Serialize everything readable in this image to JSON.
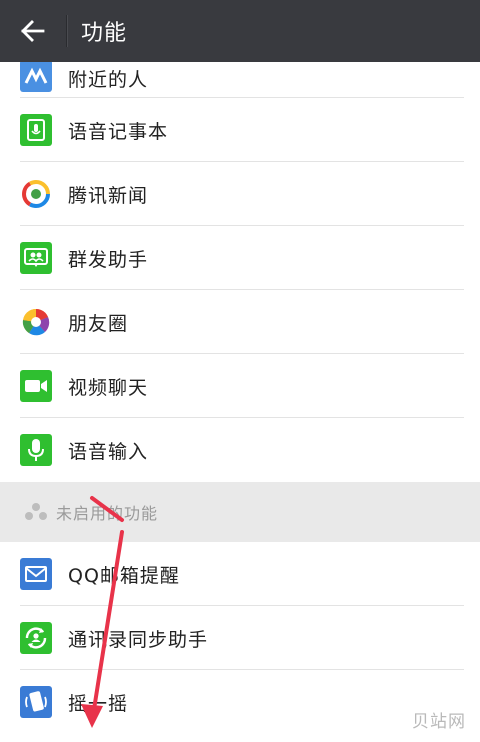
{
  "header": {
    "title": "功能",
    "back_icon": "arrow-left-icon"
  },
  "features": [
    {
      "label": "附近的人",
      "icon": "nearby-people-icon",
      "color": "#4a90e2"
    },
    {
      "label": "语音记事本",
      "icon": "voice-notepad-icon",
      "color": "#2fbf30"
    },
    {
      "label": "腾讯新闻",
      "icon": "tencent-news-icon",
      "color": "#ffffff"
    },
    {
      "label": "群发助手",
      "icon": "broadcast-assistant-icon",
      "color": "#2fbf30"
    },
    {
      "label": "朋友圈",
      "icon": "moments-icon",
      "color": "#ffffff"
    },
    {
      "label": "视频聊天",
      "icon": "video-chat-icon",
      "color": "#2fbf30"
    },
    {
      "label": "语音输入",
      "icon": "voice-input-icon",
      "color": "#2fbf30"
    }
  ],
  "disabled_section": {
    "label": "未启用的功能"
  },
  "disabled_features": [
    {
      "label": "QQ邮箱提醒",
      "icon": "qq-mail-icon",
      "color": "#3a7bd5"
    },
    {
      "label": "通讯录同步助手",
      "icon": "contacts-sync-icon",
      "color": "#2fbf30"
    },
    {
      "label": "摇一摇",
      "icon": "shake-icon",
      "color": "#3a7bd5"
    }
  ],
  "watermark": "贝站网",
  "colors": {
    "topbar": "#393a3f",
    "arrow": "#e8334a"
  }
}
